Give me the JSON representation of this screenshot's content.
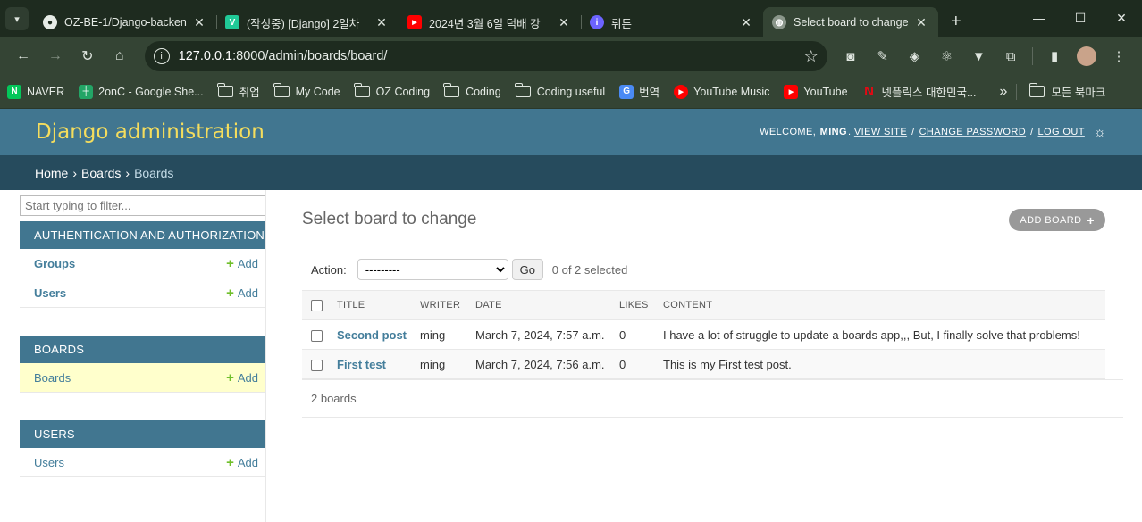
{
  "browser": {
    "tabs": [
      {
        "title": "OZ-BE-1/Django-backen",
        "icon": "github-icon",
        "active": false
      },
      {
        "title": "(작성중) [Django] 2일차",
        "icon": "velog-icon",
        "active": false
      },
      {
        "title": "2024년 3월 6일 덕배 강",
        "icon": "youtube-icon",
        "active": false
      },
      {
        "title": "뤼튼",
        "icon": "wrtn-icon",
        "active": false
      },
      {
        "title": "Select board to change",
        "icon": "globe-icon",
        "active": true
      }
    ],
    "url_host": "127.0.0.1",
    "url_path": ":8000/admin/boards/board/",
    "bookmarks": [
      {
        "label": "NAVER",
        "icon": "naver-icon",
        "color": "#03c75a"
      },
      {
        "label": "2onC - Google She...",
        "icon": "sheets-icon",
        "color": "#23a566"
      },
      {
        "label": "취업",
        "icon": "folder-icon"
      },
      {
        "label": "My Code",
        "icon": "folder-icon"
      },
      {
        "label": "OZ Coding",
        "icon": "folder-icon"
      },
      {
        "label": "Coding",
        "icon": "folder-icon"
      },
      {
        "label": "Coding useful",
        "icon": "folder-icon"
      },
      {
        "label": "번역",
        "icon": "translate-icon",
        "color": "#4a8af4"
      },
      {
        "label": "YouTube Music",
        "icon": "youtube-music-icon",
        "color": "#ff0000"
      },
      {
        "label": "YouTube",
        "icon": "youtube-icon",
        "color": "#ff0000"
      },
      {
        "label": "넷플릭스 대한민국...",
        "icon": "netflix-icon",
        "color": "#e50914"
      }
    ],
    "all_bookmarks": "모든 북마크"
  },
  "admin": {
    "brand": "Django administration",
    "welcome": "WELCOME,",
    "user": "MING",
    "view_site": "VIEW SITE",
    "change_password": "CHANGE PASSWORD",
    "log_out": "LOG OUT",
    "breadcrumbs": {
      "home": "Home",
      "app": "Boards",
      "model": "Boards"
    },
    "filter_placeholder": "Start typing to filter...",
    "modules": [
      {
        "caption": "AUTHENTICATION AND AUTHORIZATION",
        "rows": [
          {
            "model": "Groups",
            "add": "Add",
            "current": false
          },
          {
            "model": "Users",
            "add": "Add",
            "current": false
          }
        ]
      },
      {
        "caption": "BOARDS",
        "rows": [
          {
            "model": "Boards",
            "add": "Add",
            "current": true
          }
        ]
      },
      {
        "caption": "USERS",
        "rows": [
          {
            "model": "Users",
            "add": "Add",
            "current": false
          }
        ]
      }
    ],
    "page_title": "Select board to change",
    "add_button": "ADD BOARD",
    "action_label": "Action:",
    "action_selected": "---------",
    "go": "Go",
    "selection_count": "0 of 2 selected",
    "columns": [
      "TITLE",
      "WRITER",
      "DATE",
      "LIKES",
      "CONTENT"
    ],
    "rows": [
      {
        "title": "Second post",
        "writer": "ming",
        "date": "March 7, 2024, 7:57 a.m.",
        "likes": "0",
        "content": "I have a lot of struggle to update a boards app,,, But, I finally solve that problems!"
      },
      {
        "title": "First test",
        "writer": "ming",
        "date": "March 7, 2024, 7:56 a.m.",
        "likes": "0",
        "content": "This is my First test post."
      }
    ],
    "paginator": "2 boards"
  }
}
